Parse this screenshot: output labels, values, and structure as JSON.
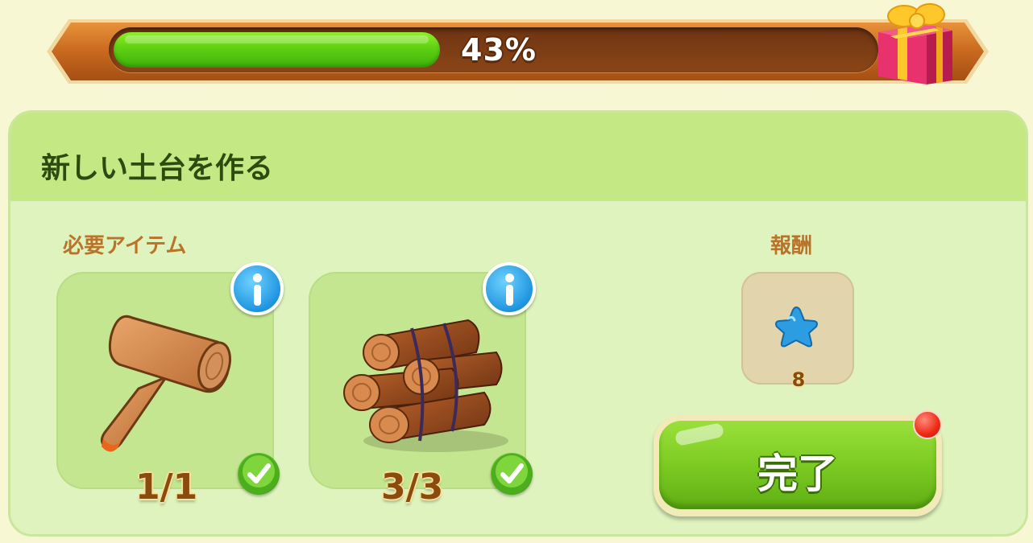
{
  "progress": {
    "percent_text": "43%",
    "value_fraction": 0.43
  },
  "quest": {
    "title": "新しい土台を作る",
    "required_label": "必要アイテム",
    "reward_label": "報酬",
    "items": [
      {
        "icon": "wooden-mallet-icon",
        "count": "1/1",
        "complete": true
      },
      {
        "icon": "lumber-bundle-icon",
        "count": "3/3",
        "complete": true
      }
    ],
    "reward": {
      "icon": "blue-star-icon",
      "amount": "8"
    },
    "complete_button": "完了"
  },
  "colors": {
    "progress_fill": "#5fd012",
    "panel_bg": "#dff3bf",
    "header_bg": "#c3e884",
    "accent_text": "#b9732a",
    "button_green": "#7ccb22"
  }
}
